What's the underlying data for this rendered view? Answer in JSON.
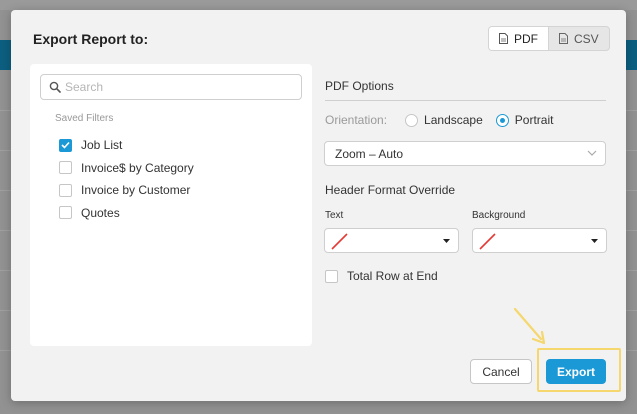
{
  "dialog": {
    "title": "Export Report to:",
    "formats": [
      {
        "label": "PDF",
        "icon": "pdf-file-icon",
        "active": true
      },
      {
        "label": "CSV",
        "icon": "csv-file-icon",
        "active": false
      }
    ]
  },
  "filters": {
    "search_placeholder": "Search",
    "saved_label": "Saved Filters",
    "items": [
      {
        "label": "Job List",
        "checked": true
      },
      {
        "label": "Invoice$ by Category",
        "checked": false
      },
      {
        "label": "Invoice by Customer",
        "checked": false
      },
      {
        "label": "Quotes",
        "checked": false
      }
    ]
  },
  "pdf_options": {
    "title": "PDF Options",
    "orientation_label": "Orientation",
    "orientation_options": [
      "Landscape",
      "Portrait"
    ],
    "orientation_selected": "Portrait",
    "zoom_value": "Zoom – Auto",
    "header_override_title": "Header Format Override",
    "text_label": "Text",
    "background_label": "Background",
    "total_row_label": "Total Row at End"
  },
  "footer": {
    "cancel_label": "Cancel",
    "export_label": "Export"
  },
  "colors": {
    "accent": "#1a99d6",
    "highlight": "#f5d76e",
    "background_band": "#0c5f80"
  }
}
